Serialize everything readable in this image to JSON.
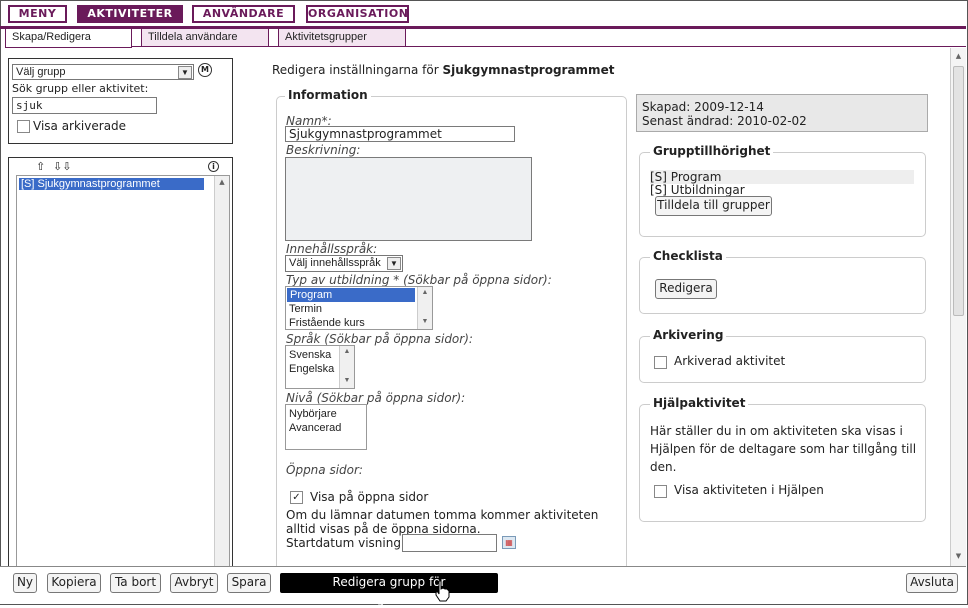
{
  "nav": {
    "items": [
      "MENY",
      "AKTIVITETER",
      "ANVÄNDARE",
      "ORGANISATION"
    ]
  },
  "tabs": [
    "Skapa/Redigera",
    "Tilldela användare",
    "Aktivitetsgrupper"
  ],
  "left": {
    "group_select": "Välj grupp",
    "m_icon": "M",
    "search_label": "Sök grupp eller aktivitet:",
    "search_value": "sjuk",
    "archived_label": "Visa arkiverade",
    "tree_item": "[S] Sjukgymnastprogrammet"
  },
  "heading": {
    "prefix": "Redigera inställningarna för ",
    "name": "Sjukgymnastprogrammet"
  },
  "info": {
    "legend": "Information",
    "name_label": "Namn*:",
    "name_value": "Sjukgymnastprogrammet",
    "desc_label": "Beskrivning:",
    "lang_label": "Innehållsspråk:",
    "lang_select": "Välj innehållsspråk",
    "type_label": "Typ av utbildning * (Sökbar på öppna sidor):",
    "type_options": [
      "Program",
      "Termin",
      "Fristående kurs"
    ],
    "sprak_label": "Språk (Sökbar på öppna sidor):",
    "sprak_options": [
      "Svenska",
      "Engelska"
    ],
    "niva_label": "Nivå (Sökbar på öppna sidor):",
    "niva_options": [
      "Nybörjare",
      "Avancerad"
    ],
    "open_label": "Öppna sidor:",
    "show_open_label": "Visa på öppna sidor",
    "note": "Om du lämnar datumen tomma kommer aktiviteten alltid visas på de öppna sidorna.",
    "start_label": "Startdatum visning:"
  },
  "meta": {
    "created": "Skapad: 2009-12-14",
    "changed": "Senast ändrad: 2010-02-02"
  },
  "groups": {
    "legend": "Grupptillhörighet",
    "items": [
      "[S] Program",
      "[S] Utbildningar"
    ],
    "assign_button": "Tilldela till grupper"
  },
  "checklist": {
    "legend": "Checklista",
    "button": "Redigera"
  },
  "archiving": {
    "legend": "Arkivering",
    "label": "Arkiverad aktivitet"
  },
  "help": {
    "legend": "Hjälpaktivitet",
    "text": "Här ställer du in om aktiviteten ska visas i Hjälpen för de deltagare som har tillgång till den.",
    "label": "Visa aktiviteten i Hjälpen"
  },
  "bottom": {
    "buttons": [
      "Ny",
      "Kopiera",
      "Ta bort",
      "Avbryt",
      "Spara"
    ],
    "primary": "Redigera grupp för samlingsaktivitet",
    "exit": "Avsluta"
  },
  "colors": {
    "accent": "#6a1a5a",
    "selection": "#3a6bc8"
  }
}
